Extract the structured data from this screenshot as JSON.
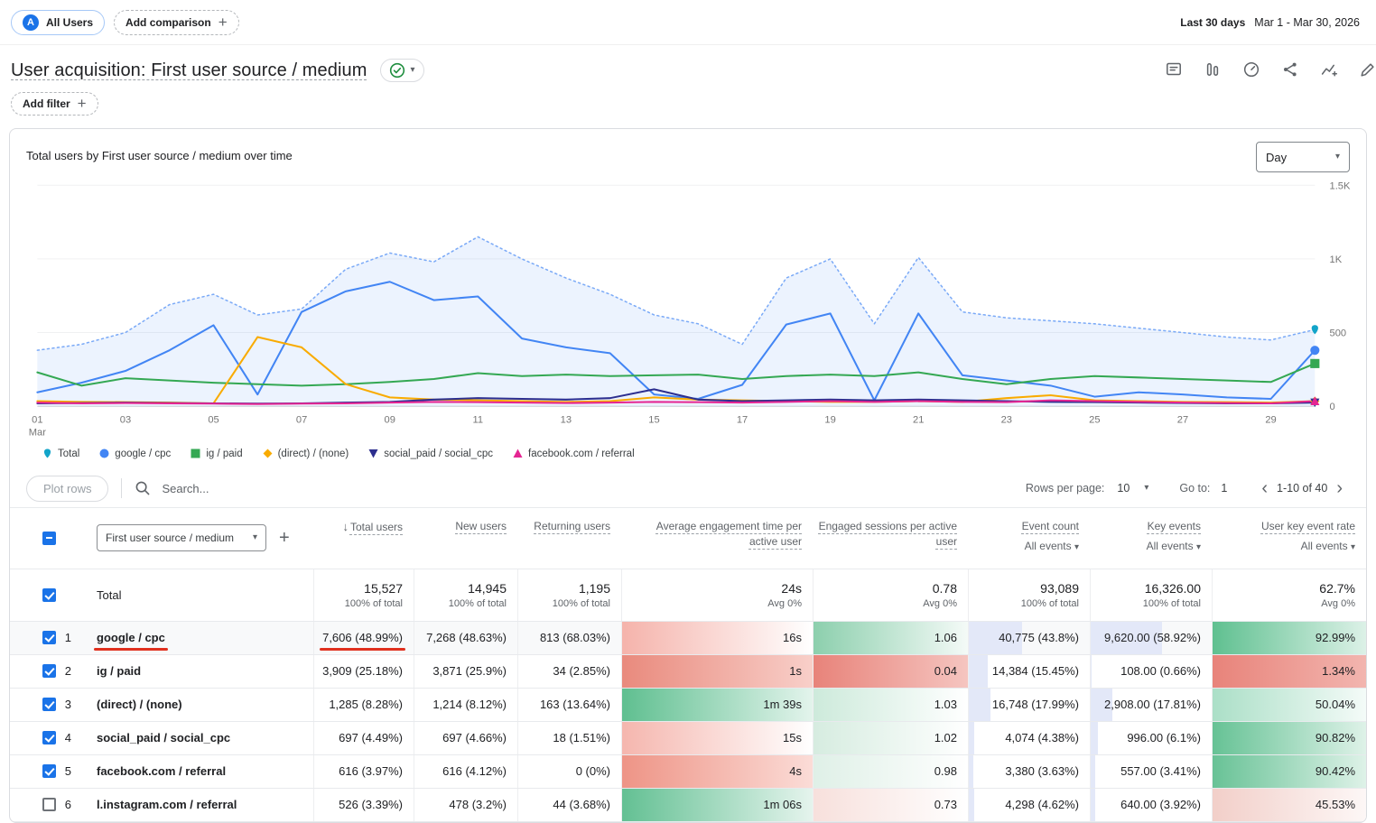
{
  "colors": {
    "accent": "#1a73e8",
    "annotation_red": "#e0301e",
    "event_bar": "#e3e8f8",
    "heat_green": "#57bb8a",
    "heat_red": "#e67c73"
  },
  "top_bar": {
    "audience_avatar": "A",
    "audience_chip": "All Users",
    "add_comparison_label": "Add comparison",
    "date_preset": "Last 30 days",
    "date_range": "Mar 1 - Mar 30, 2026"
  },
  "report_header": {
    "title": "User acquisition: First user source / medium",
    "add_filter_label": "Add filter"
  },
  "chart_card": {
    "title": "Total users by First user source / medium over time",
    "granularity": "Day"
  },
  "chart_data": {
    "type": "line",
    "title": "Total users by First user source / medium over time",
    "x_unit": "day of March",
    "x": [
      1,
      2,
      3,
      4,
      5,
      6,
      7,
      8,
      9,
      10,
      11,
      12,
      13,
      14,
      15,
      16,
      17,
      18,
      19,
      20,
      21,
      22,
      23,
      24,
      25,
      26,
      27,
      28,
      29,
      30
    ],
    "x_tick_labels": [
      "01",
      "03",
      "05",
      "07",
      "09",
      "11",
      "13",
      "15",
      "17",
      "19",
      "21",
      "23",
      "25",
      "27",
      "29"
    ],
    "x_first_tick_sub": "Mar",
    "ylim": [
      0,
      1500
    ],
    "yticks": [
      0,
      500,
      1000,
      1500
    ],
    "ytick_labels": [
      "0",
      "500",
      "1K",
      "1.5K"
    ],
    "grid": "horizontal",
    "legend_position": "bottom",
    "series": [
      {
        "name": "Total",
        "marker": "pin",
        "color": "#12a4c9",
        "line_color": "#7baaf7",
        "style": "dotted",
        "fill": true,
        "fill_color": "rgba(66,133,244,0.10)",
        "width": 1.5,
        "values": [
          380,
          420,
          500,
          690,
          760,
          620,
          660,
          930,
          1040,
          980,
          1150,
          1000,
          870,
          760,
          620,
          560,
          420,
          870,
          1000,
          560,
          1010,
          640,
          600,
          580,
          560,
          530,
          500,
          470,
          450,
          520
        ]
      },
      {
        "name": "google / cpc",
        "marker": "circle",
        "color": "#4285f4",
        "style": "solid",
        "width": 2,
        "values": [
          95,
          160,
          240,
          380,
          550,
          80,
          640,
          780,
          845,
          720,
          745,
          460,
          400,
          360,
          80,
          50,
          145,
          555,
          630,
          40,
          630,
          210,
          175,
          140,
          65,
          95,
          80,
          60,
          50,
          380
        ]
      },
      {
        "name": "ig / paid",
        "marker": "square",
        "color": "#34a853",
        "style": "solid",
        "width": 2,
        "values": [
          230,
          140,
          190,
          175,
          160,
          150,
          140,
          150,
          165,
          185,
          225,
          205,
          215,
          205,
          210,
          215,
          185,
          205,
          215,
          205,
          230,
          185,
          150,
          185,
          205,
          195,
          185,
          175,
          165,
          290
        ]
      },
      {
        "name": "(direct) / (none)",
        "marker": "diamond",
        "color": "#f9ab00",
        "style": "solid",
        "width": 2,
        "values": [
          35,
          30,
          28,
          25,
          20,
          470,
          400,
          150,
          60,
          45,
          40,
          35,
          30,
          35,
          60,
          45,
          40,
          35,
          30,
          30,
          35,
          30,
          55,
          75,
          40,
          35,
          30,
          28,
          25,
          35
        ]
      },
      {
        "name": "social_paid / social_cpc",
        "marker": "triangle-down",
        "color": "#2d2f8f",
        "style": "solid",
        "width": 2,
        "values": [
          20,
          22,
          25,
          22,
          20,
          18,
          20,
          25,
          30,
          45,
          55,
          50,
          45,
          55,
          115,
          45,
          35,
          40,
          45,
          40,
          45,
          40,
          35,
          30,
          28,
          25,
          22,
          20,
          20,
          25
        ]
      },
      {
        "name": "facebook.com / referral",
        "marker": "triangle-up",
        "color": "#e52592",
        "style": "solid",
        "width": 2,
        "values": [
          25,
          20,
          22,
          20,
          18,
          15,
          18,
          20,
          25,
          30,
          28,
          25,
          22,
          25,
          30,
          28,
          25,
          30,
          35,
          30,
          35,
          30,
          28,
          40,
          35,
          30,
          25,
          22,
          20,
          35
        ]
      }
    ]
  },
  "table": {
    "toolbar": {
      "plot_rows_label": "Plot rows",
      "search_placeholder": "Search...",
      "rows_per_page_label": "Rows per page:",
      "rows_per_page_value": "10",
      "go_to_label": "Go to:",
      "go_to_value": "1",
      "pagination_range": "1-10 of 40"
    },
    "dimension_label": "First user source / medium",
    "columns": [
      {
        "key": "total_users",
        "label": "Total users",
        "sorted": true
      },
      {
        "key": "new_users",
        "label": "New users"
      },
      {
        "key": "returning_users",
        "label": "Returning users"
      },
      {
        "key": "avg_engagement_time",
        "label": "Average engagement time per active user"
      },
      {
        "key": "engaged_sessions",
        "label": "Engaged sessions per active user"
      },
      {
        "key": "event_count",
        "label": "Event count",
        "filter_label": "All events"
      },
      {
        "key": "key_events",
        "label": "Key events",
        "filter_label": "All events"
      },
      {
        "key": "user_key_event_rate",
        "label": "User key event rate",
        "filter_label": "All events"
      }
    ],
    "totals": {
      "label": "Total",
      "values": [
        "15,527",
        "14,945",
        "1,195",
        "24s",
        "0.78",
        "93,089",
        "16,326.00",
        "62.7%"
      ],
      "subs": [
        "100% of total",
        "100% of total",
        "100% of total",
        "Avg 0%",
        "Avg 0%",
        "100% of total",
        "100% of total",
        "Avg 0%"
      ]
    },
    "rows": [
      {
        "index": 1,
        "checked": true,
        "highlight": true,
        "annotate": [
          "label",
          "total_users"
        ],
        "name": "google / cpc",
        "cells": [
          "7,606 (48.99%)",
          "7,268 (48.63%)",
          "813 (68.03%)",
          "16s",
          "1.06",
          "40,775 (43.8%)",
          "9,620.00 (58.92%)",
          "92.99%"
        ],
        "heat": {
          "aet": [
            "#f5b3ab",
            "#ffffff"
          ],
          "es": [
            "#8ccfad",
            "#f4faf7"
          ],
          "rate": [
            "#5fc090",
            "#dcf1e7"
          ],
          "ec_pct": 43.8,
          "ke_pct": 58.92
        }
      },
      {
        "index": 2,
        "checked": true,
        "name": "ig / paid",
        "cells": [
          "3,909 (25.18%)",
          "3,871 (25.9%)",
          "34 (2.85%)",
          "1s",
          "0.04",
          "14,384 (15.45%)",
          "108.00 (0.66%)",
          "1.34%"
        ],
        "heat": {
          "aet": [
            "#e98a7d",
            "#f8cfc9"
          ],
          "es": [
            "#e8837a",
            "#f5c5c0"
          ],
          "rate": [
            "#e8837a",
            "#f2b5af"
          ],
          "ec_pct": 15.45,
          "ke_pct": 0.66
        }
      },
      {
        "index": 3,
        "checked": true,
        "name": "(direct) / (none)",
        "cells": [
          "1,285 (8.28%)",
          "1,214 (8.12%)",
          "163 (13.64%)",
          "1m 39s",
          "1.03",
          "16,748 (17.99%)",
          "2,908.00 (17.81%)",
          "50.04%"
        ],
        "heat": {
          "aet": [
            "#5fbf90",
            "#e3f4ec"
          ],
          "es": [
            "#cdeadb",
            "#ffffff"
          ],
          "rate": [
            "#abdfc7",
            "#f4fbf8"
          ],
          "ec_pct": 17.99,
          "ke_pct": 17.81
        }
      },
      {
        "index": 4,
        "checked": true,
        "name": "social_paid / social_cpc",
        "cells": [
          "697 (4.49%)",
          "697 (4.66%)",
          "18 (1.51%)",
          "15s",
          "1.02",
          "4,074 (4.38%)",
          "996.00 (6.1%)",
          "90.82%"
        ],
        "heat": {
          "aet": [
            "#f5b6ae",
            "#ffffff"
          ],
          "es": [
            "#d6ece0",
            "#ffffff"
          ],
          "rate": [
            "#66c295",
            "#def2e8"
          ],
          "ec_pct": 4.38,
          "ke_pct": 6.1
        }
      },
      {
        "index": 5,
        "checked": true,
        "name": "facebook.com / referral",
        "cells": [
          "616 (3.97%)",
          "616 (4.12%)",
          "0 (0%)",
          "4s",
          "0.98",
          "3,380 (3.63%)",
          "557.00 (3.41%)",
          "90.42%"
        ],
        "heat": {
          "aet": [
            "#ee9486",
            "#fbdcd7"
          ],
          "es": [
            "#dff0e7",
            "#ffffff"
          ],
          "rate": [
            "#68c296",
            "#def2e8"
          ],
          "ec_pct": 3.63,
          "ke_pct": 3.41
        }
      },
      {
        "index": 6,
        "checked": false,
        "name": "l.instagram.com / referral",
        "cells": [
          "526 (3.39%)",
          "478 (3.2%)",
          "44 (3.68%)",
          "1m 06s",
          "0.73",
          "4,298 (4.62%)",
          "640.00 (3.92%)",
          "45.53%"
        ],
        "heat": {
          "aet": [
            "#63c093",
            "#e5f4ed"
          ],
          "es": [
            "#f7e0dc",
            "#ffffff"
          ],
          "rate": [
            "#f2cfc9",
            "#fdf7f6"
          ],
          "ec_pct": 4.62,
          "ke_pct": 3.92
        }
      }
    ]
  }
}
